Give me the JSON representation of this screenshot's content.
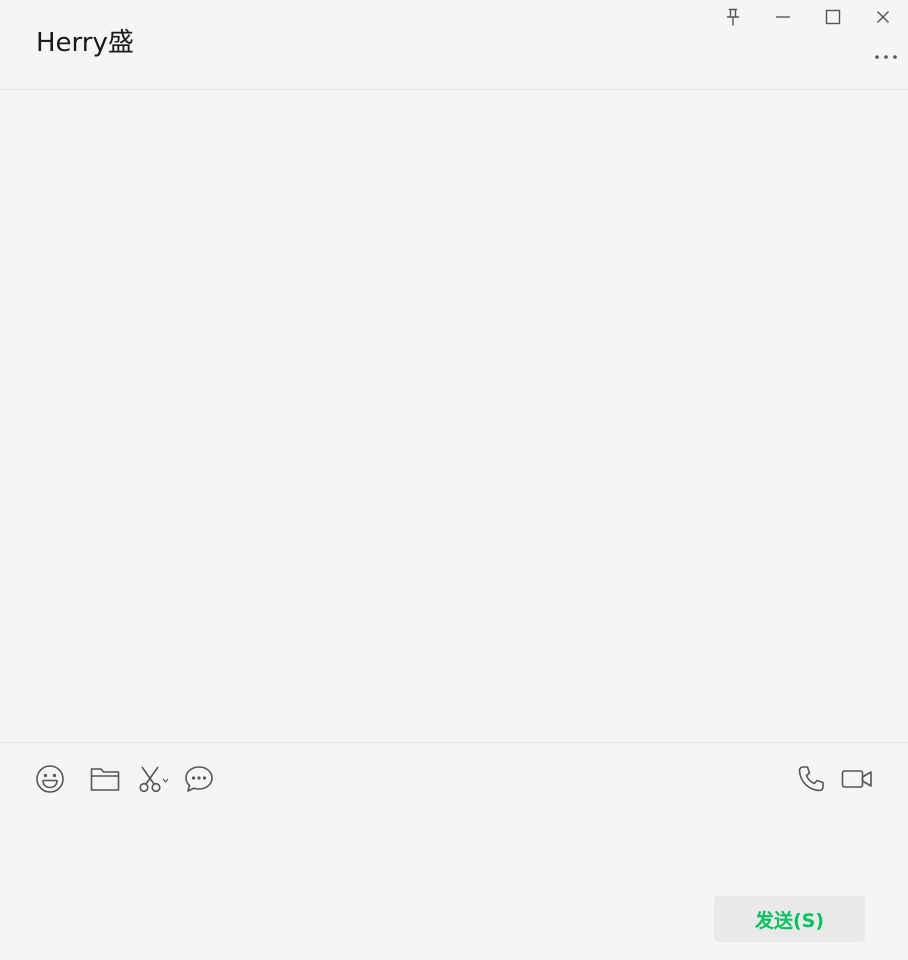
{
  "header": {
    "title": "Herry盛"
  },
  "window_controls": {
    "pin": "pin-icon",
    "minimize": "minimize-icon",
    "maximize": "maximize-icon",
    "close": "close-icon",
    "more": "more-icon"
  },
  "toolbar": {
    "left_tools": [
      "emoji-icon",
      "folder-icon",
      "scissors-icon",
      "chat-history-icon"
    ],
    "right_tools": [
      "phone-icon",
      "video-call-icon"
    ]
  },
  "input": {
    "value": ""
  },
  "send_button": {
    "label": "发送(S)"
  },
  "colors": {
    "background": "#f5f5f5",
    "send_text": "#07c160",
    "send_bg": "#e9e9e9",
    "icon": "#555555"
  }
}
